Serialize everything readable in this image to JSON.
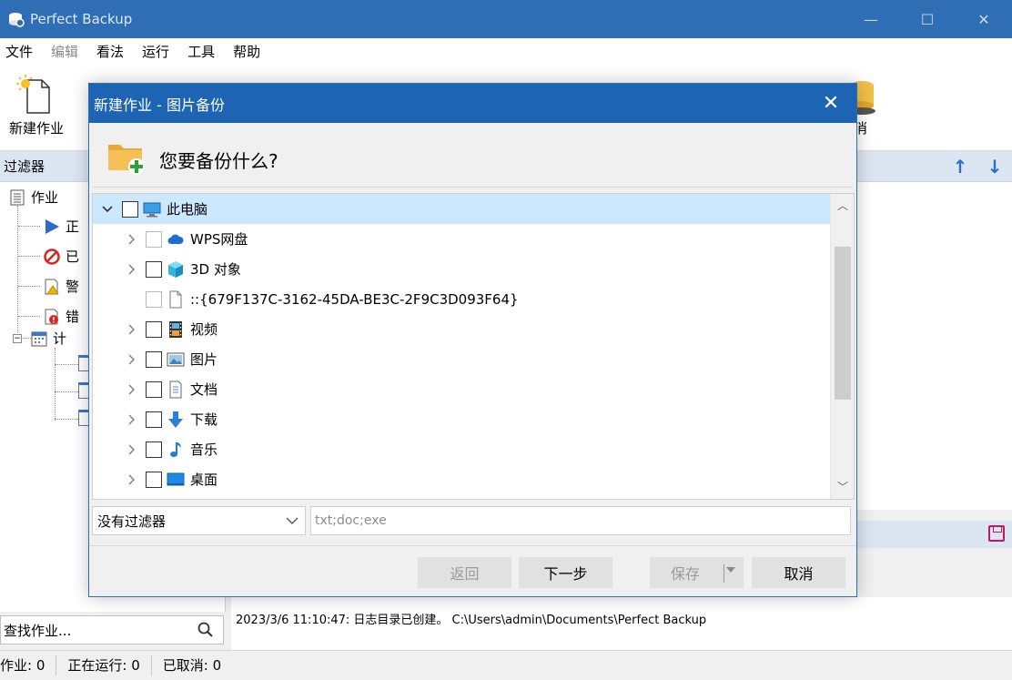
{
  "window": {
    "title": "Perfect Backup",
    "min": "—",
    "max": "☐",
    "close": "✕"
  },
  "menu": [
    {
      "label": "文件",
      "enabled": true
    },
    {
      "label": "编辑",
      "enabled": false
    },
    {
      "label": "看法",
      "enabled": true
    },
    {
      "label": "运行",
      "enabled": true
    },
    {
      "label": "工具",
      "enabled": true
    },
    {
      "label": "帮助",
      "enabled": true
    }
  ],
  "toolbar": {
    "new_job": "新建作业",
    "partial_right_label": "消"
  },
  "filter_panel": {
    "title": "过滤器",
    "tree": {
      "root": "作业",
      "items": [
        "正",
        "已",
        "警",
        "错"
      ],
      "schedule": "计"
    }
  },
  "right_panel": {
    "up_arrow": "↑",
    "down_arrow": "↓"
  },
  "search": {
    "placeholder": "查找作业..."
  },
  "log": {
    "line1": "2023/3/6 11:10:47: 日志目录已创建。 C:\\Users\\admin\\Documents\\Perfect Backup"
  },
  "status": {
    "jobs": "作业: 0",
    "running": "正在运行: 0",
    "cancelled": "已取消: 0"
  },
  "dialog": {
    "title": "新建作业 - 图片备份",
    "close": "✕",
    "question": "您要备份什么?",
    "tree": [
      {
        "label": "此电脑",
        "icon": "computer-icon",
        "level": 0,
        "expanded": true,
        "selected": true
      },
      {
        "label": "WPS网盘",
        "icon": "cloud-icon",
        "level": 1,
        "dim": true
      },
      {
        "label": "3D 对象",
        "icon": "cube-icon",
        "level": 1
      },
      {
        "label": "::{679F137C-3162-45DA-BE3C-2F9C3D093F64}",
        "icon": "file-icon",
        "level": 1,
        "dim": true,
        "no_chevron": true
      },
      {
        "label": "视频",
        "icon": "film-icon",
        "level": 1
      },
      {
        "label": "图片",
        "icon": "picture-icon",
        "level": 1
      },
      {
        "label": "文档",
        "icon": "document-icon",
        "level": 1
      },
      {
        "label": "下载",
        "icon": "download-icon",
        "level": 1
      },
      {
        "label": "音乐",
        "icon": "music-icon",
        "level": 1
      },
      {
        "label": "桌面",
        "icon": "desktop-icon",
        "level": 1
      }
    ],
    "filter_select": "没有过滤器",
    "filter_input": "txt;doc;exe",
    "buttons": {
      "back": "返回",
      "next": "下一步",
      "save": "保存",
      "cancel": "取消"
    }
  }
}
